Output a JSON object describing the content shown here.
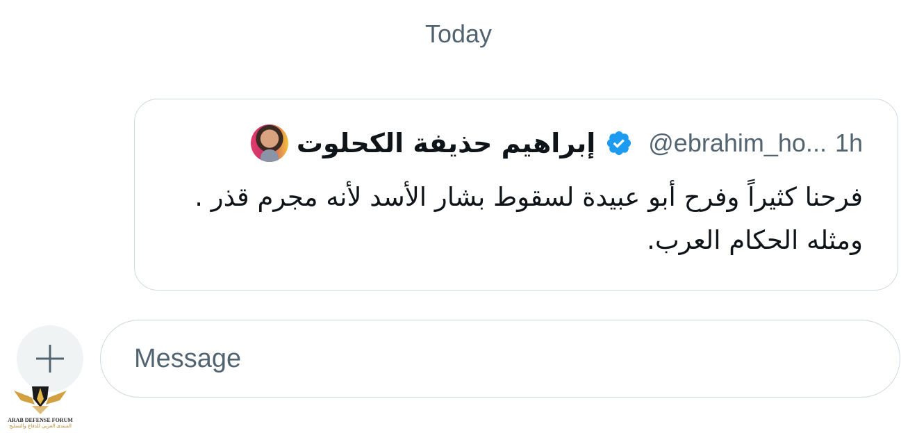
{
  "conversation": {
    "date_separator": "Today"
  },
  "tweet": {
    "author_name": "إبراهيم حذيفة الكحلوت",
    "verified": true,
    "handle": "@ebrahim_ho...",
    "time": "1h",
    "text": "فرحنا كثيراً وفرح أبو عبيدة لسقوط بشار الأسد لأنه مجرم قذر . ومثله الحكام العرب."
  },
  "composer": {
    "placeholder": "Message",
    "value": "",
    "add_icon": "plus-icon"
  },
  "watermark": {
    "name": "ARAB DEFENSE FORUM",
    "subtitle": "المنتدى العربي للدفاع والتسليح",
    "monogram": "DA"
  },
  "colors": {
    "muted_text": "#536471",
    "border": "#cfd9de",
    "verified_blue": "#1d9bf0",
    "add_button_bg": "#eff3f4"
  }
}
